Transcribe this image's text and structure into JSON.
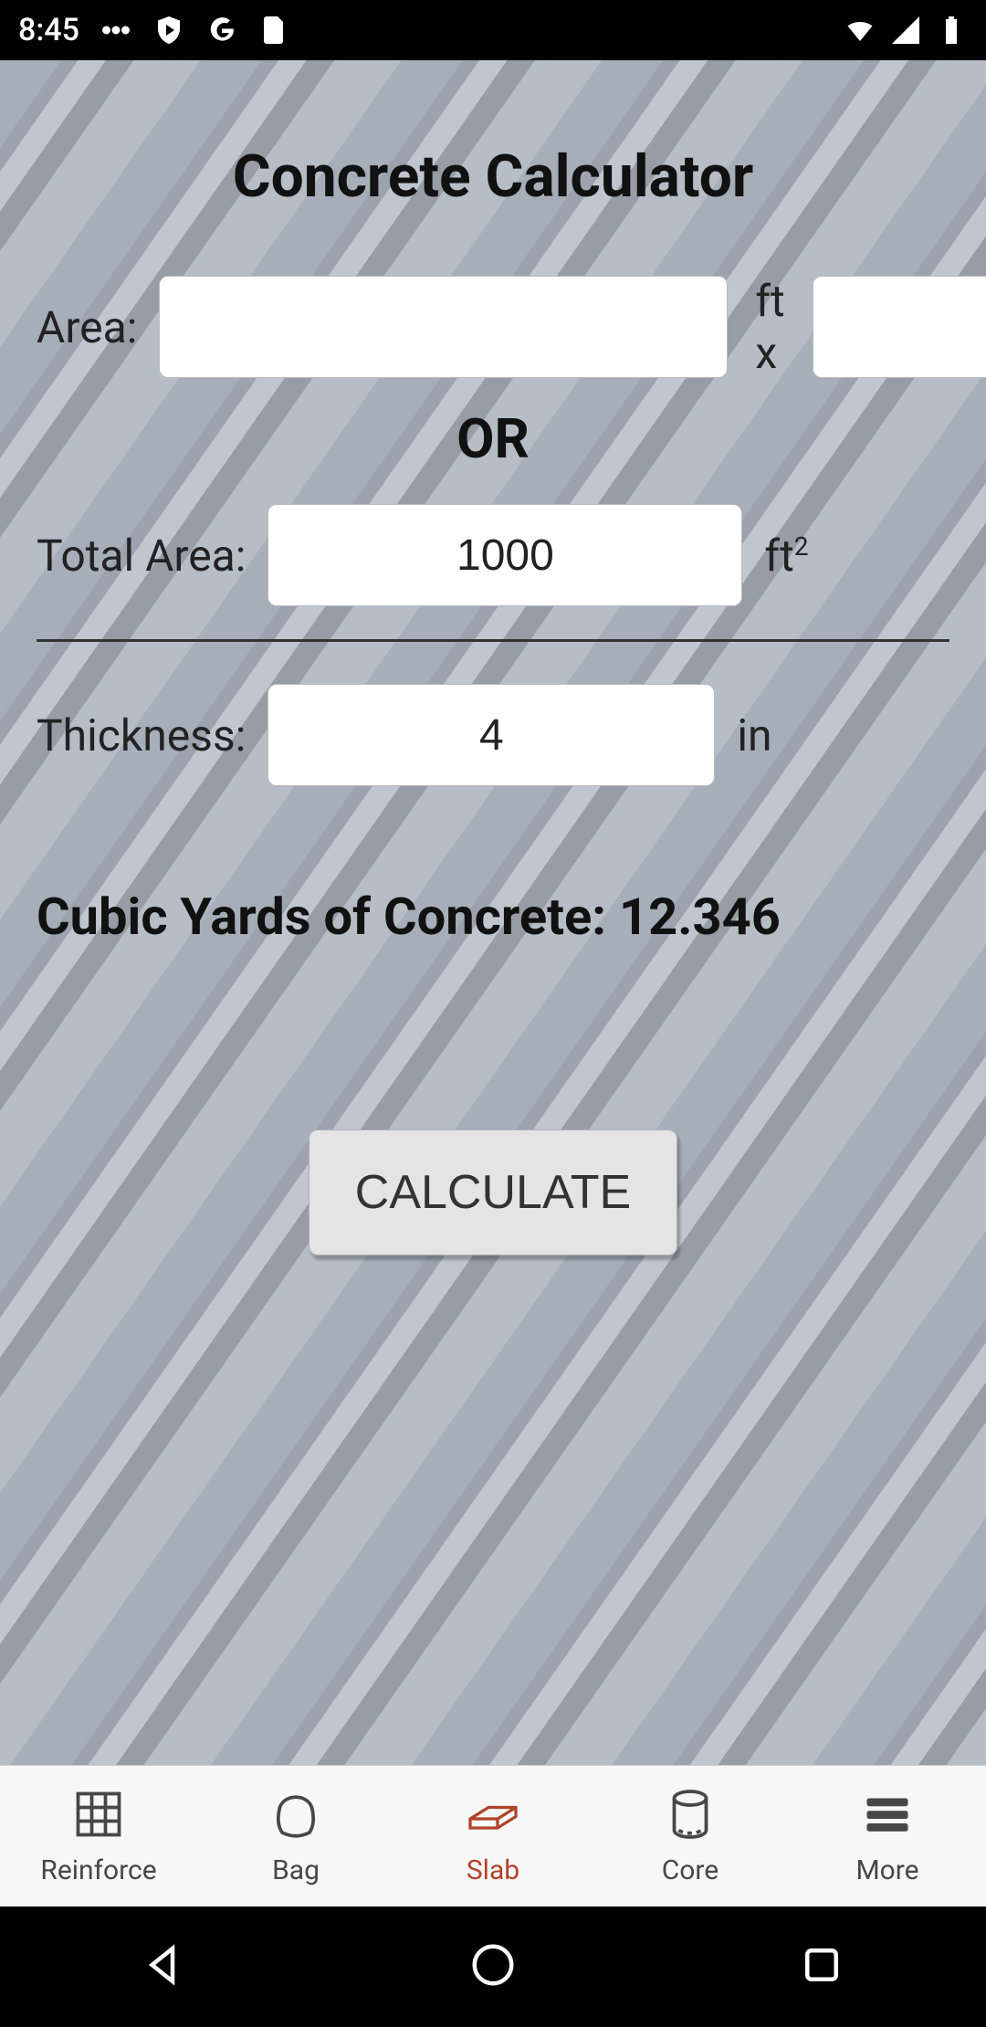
{
  "status": {
    "time": "8:45"
  },
  "header": {
    "title": "Concrete Calculator"
  },
  "form": {
    "area_label": "Area:",
    "area_width_value": "",
    "area_mid": "ft x",
    "area_height_value": "",
    "area_unit_after": "ft",
    "or_text": "OR",
    "total_area_label": "Total Area:",
    "total_area_value": "1000",
    "total_area_unit_prefix": "ft",
    "total_area_unit_suffix": "2",
    "thickness_label": "Thickness:",
    "thickness_value": "4",
    "thickness_unit": "in"
  },
  "result": {
    "text": "Cubic Yards of Concrete: 12.346"
  },
  "actions": {
    "calculate_label": "CALCULATE"
  },
  "tabs": {
    "reinforce": "Reinforce",
    "bag": "Bag",
    "slab": "Slab",
    "core": "Core",
    "more": "More"
  },
  "colors": {
    "active_tab": "#b1432a"
  }
}
